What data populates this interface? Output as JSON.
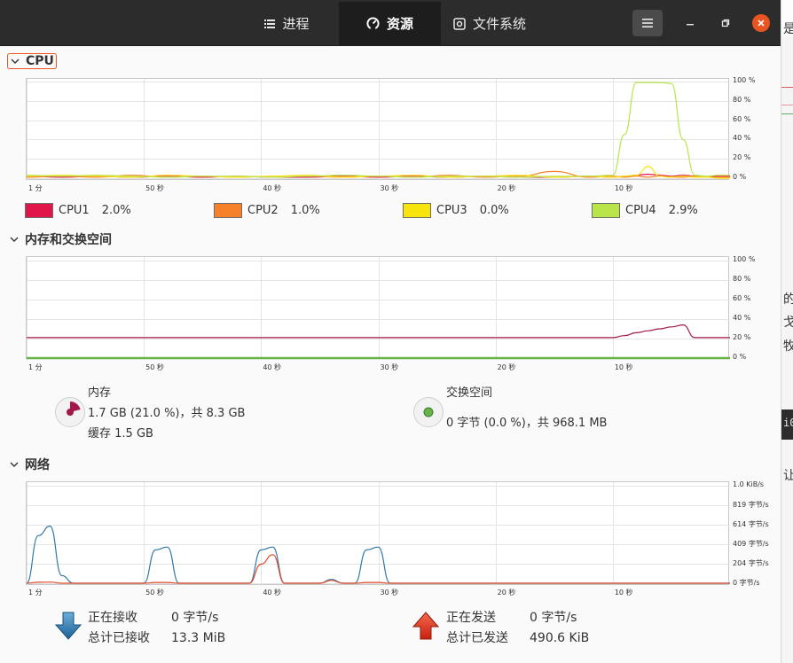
{
  "tabs": [
    {
      "label": "进程",
      "icon": "list-icon"
    },
    {
      "label": "资源",
      "icon": "gauge-icon"
    },
    {
      "label": "文件系统",
      "icon": "disk-icon"
    }
  ],
  "active_tab": "资源",
  "window_buttons": {
    "menu_icon": "hamburger-icon",
    "minimize_icon": "minimize-icon",
    "restore_icon": "restore-icon",
    "close_icon": "close-icon"
  },
  "colors": {
    "accent": "#e95420",
    "cpu1": "#e0164a",
    "cpu2": "#f5822a",
    "cpu3": "#f8e40d",
    "cpu4": "#b9e44a",
    "memory": "#a3184a",
    "swap": "#68b24a",
    "receive": "#3178a8",
    "send": "#e24a2b"
  },
  "edge_strip": [
    "是",
    "的",
    "戈",
    "牧",
    "i0",
    "让"
  ],
  "x_ticks": [
    "1 分",
    "50 秒",
    "40 秒",
    "30 秒",
    "20 秒",
    "10 秒"
  ],
  "cpu": {
    "title": "CPU",
    "y_ticks": [
      "100 %",
      "80 %",
      "60 %",
      "40 %",
      "20 %",
      "0 %"
    ],
    "legend": [
      {
        "name": "CPU1",
        "value": "2.0%"
      },
      {
        "name": "CPU2",
        "value": "1.0%"
      },
      {
        "name": "CPU3",
        "value": "0.0%"
      },
      {
        "name": "CPU4",
        "value": "2.9%"
      }
    ]
  },
  "memory": {
    "title": "内存和交换空间",
    "y_ticks": [
      "100 %",
      "80 %",
      "60 %",
      "40 %",
      "20 %",
      "0 %"
    ],
    "mem_label": "内存",
    "mem_usage": "1.7 GB (21.0 %)，共 8.3 GB",
    "mem_cache": "缓存 1.5 GB",
    "mem_fraction": 0.21,
    "swap_label": "交换空间",
    "swap_usage": "0 字节 (0.0 %)，共 968.1 MB",
    "swap_fraction": 0.0
  },
  "network": {
    "title": "网络",
    "y_ticks": [
      "1.0 KiB/s",
      "819 字节/s",
      "614 字节/s",
      "409 字节/s",
      "204 字节/s",
      "0 字节/s"
    ],
    "receiving_label": "正在接收",
    "receiving_value": "0 字节/s",
    "total_received_label": "总计已接收",
    "total_received_value": "13.3 MiB",
    "sending_label": "正在发送",
    "sending_value": "0 字节/s",
    "total_sent_label": "总计已发送",
    "total_sent_value": "490.6 KiB"
  },
  "chart_data": [
    {
      "type": "line",
      "title": "CPU",
      "x": [
        -60,
        -57,
        -54,
        -51,
        -48,
        -45,
        -42,
        -39,
        -36,
        -33,
        -30,
        -27,
        -24,
        -21,
        -18,
        -15,
        -12,
        -10,
        -9,
        -8,
        -7,
        -6,
        -5,
        -4,
        -3,
        -2,
        -1,
        0
      ],
      "ylim": [
        0,
        100
      ],
      "series": [
        {
          "name": "CPU1",
          "values": [
            2,
            1,
            2,
            1,
            2,
            1,
            2,
            1,
            1,
            2,
            1,
            2,
            1,
            2,
            1,
            1,
            2,
            1,
            2,
            3,
            4,
            3,
            2,
            3,
            2,
            1,
            2,
            2
          ]
        },
        {
          "name": "CPU2",
          "values": [
            1,
            2,
            1,
            3,
            1,
            2,
            1,
            2,
            2,
            1,
            2,
            1,
            3,
            1,
            2,
            7,
            1,
            2,
            1,
            2,
            1,
            2,
            1,
            1,
            2,
            1,
            1,
            1
          ]
        },
        {
          "name": "CPU3",
          "values": [
            2,
            3,
            2,
            1,
            3,
            2,
            1,
            2,
            3,
            1,
            2,
            3,
            1,
            2,
            3,
            1,
            2,
            1,
            2,
            3,
            12,
            2,
            1,
            2,
            1,
            1,
            0,
            0
          ]
        },
        {
          "name": "CPU4",
          "values": [
            3,
            2,
            3,
            2,
            1,
            2,
            2,
            1,
            2,
            3,
            2,
            1,
            2,
            2,
            1,
            2,
            2,
            3,
            45,
            99,
            99,
            99,
            98,
            40,
            3,
            2,
            3,
            3
          ]
        }
      ]
    },
    {
      "type": "line",
      "title": "内存和交换空间",
      "x": [
        -60,
        -10,
        -9,
        -8,
        -7,
        -6,
        -5,
        -4,
        -3,
        -2,
        -1,
        0
      ],
      "ylim": [
        0,
        100
      ],
      "series": [
        {
          "name": "内存",
          "values": [
            21,
            21,
            23,
            26,
            28,
            30,
            32,
            34,
            21,
            21,
            21,
            21
          ]
        },
        {
          "name": "交换空间",
          "values": [
            0,
            0,
            0,
            0,
            0,
            0,
            0,
            0,
            0,
            0,
            0,
            0
          ]
        }
      ]
    },
    {
      "type": "line",
      "title": "网络",
      "x": [
        -60,
        -59,
        -58,
        -57,
        -56,
        -50,
        -49,
        -48,
        -47,
        -41,
        -40,
        -39,
        -38,
        -35,
        -34,
        -33,
        -32,
        -31,
        -30,
        -29,
        -28,
        -20,
        0
      ],
      "ylim": [
        0,
        1024
      ],
      "series": [
        {
          "name": "正在接收",
          "values": [
            0,
            500,
            600,
            80,
            0,
            0,
            350,
            380,
            0,
            0,
            350,
            380,
            0,
            0,
            40,
            0,
            0,
            350,
            380,
            0,
            0,
            0,
            0
          ]
        },
        {
          "name": "正在发送",
          "values": [
            0,
            10,
            12,
            0,
            0,
            0,
            8,
            8,
            0,
            0,
            200,
            300,
            0,
            0,
            30,
            0,
            0,
            8,
            8,
            0,
            0,
            0,
            0
          ]
        }
      ]
    }
  ]
}
